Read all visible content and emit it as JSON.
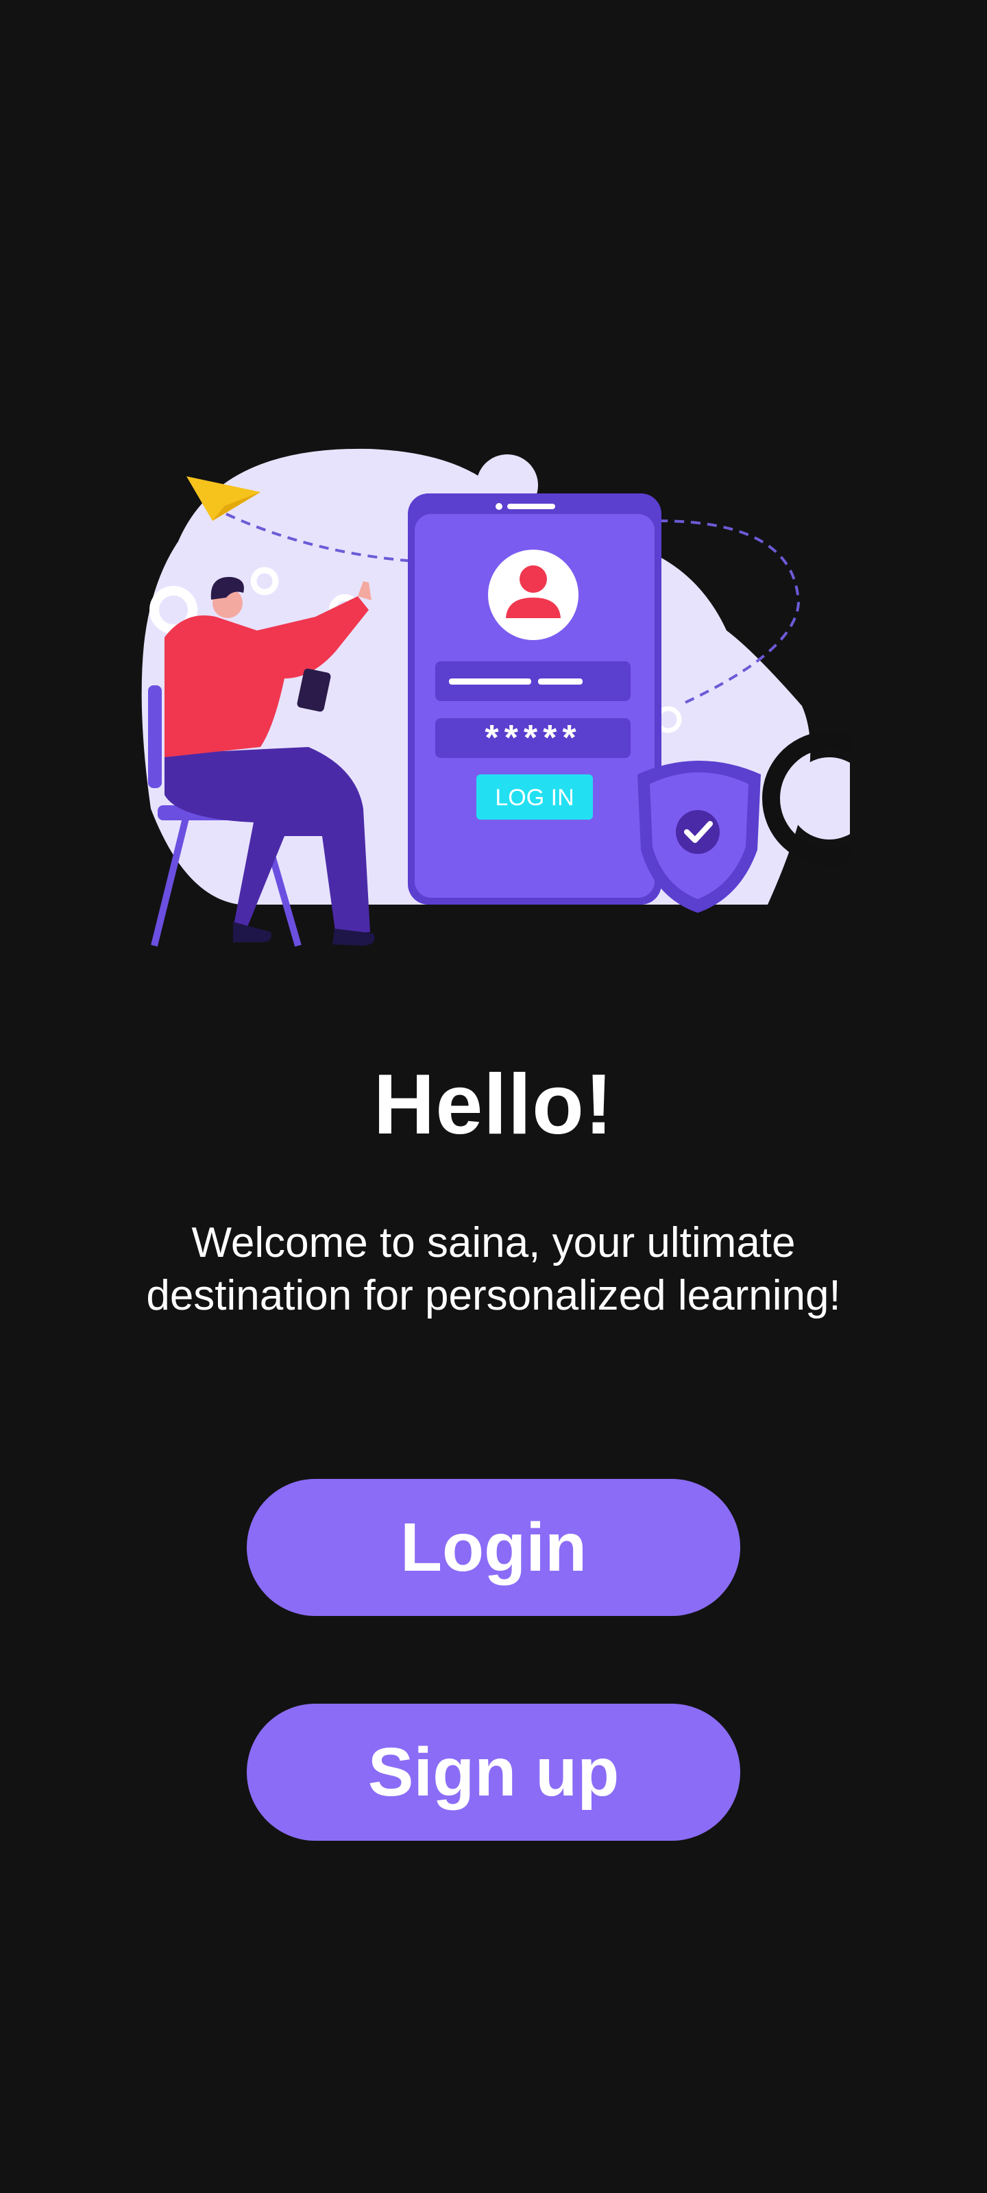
{
  "welcome": {
    "title": "Hello!",
    "message": "Welcome to saina, your ultimate destination for personalized learning!"
  },
  "illustration": {
    "password_mask": "*****",
    "login_label": "LOG IN"
  },
  "actions": {
    "login_label": "Login",
    "signup_label": "Sign up"
  },
  "colors": {
    "background": "#121212",
    "accent": "#8b6cf6",
    "phone": "#7b5cf0",
    "blob": "#e7e3fd",
    "person_shirt": "#f0374f",
    "pants": "#4b2aa8",
    "plane": "#f6c21c",
    "login_button_in_illustration": "#22e0f2"
  }
}
